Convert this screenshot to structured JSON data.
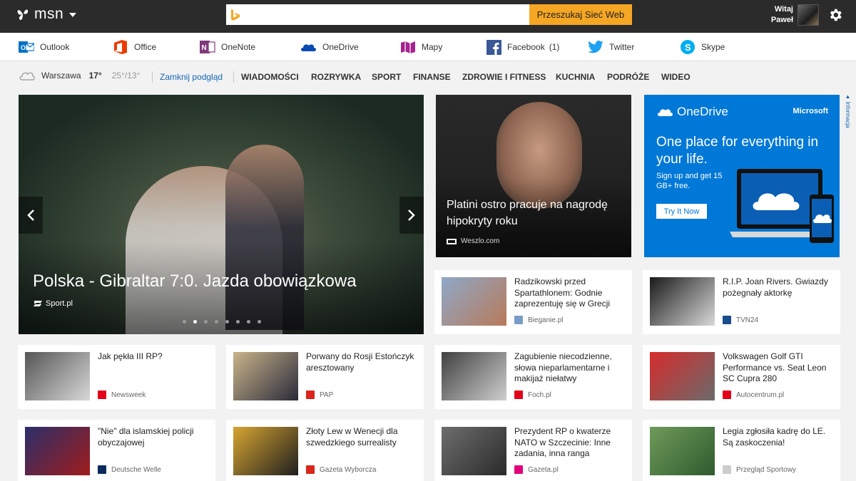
{
  "header": {
    "logo_text": "msn",
    "search_placeholder": "",
    "search_button": "Przeszukaj Sieć Web",
    "user_greeting": "Witaj",
    "user_name": "Paweł"
  },
  "apps": [
    {
      "label": "Outlook",
      "icon": "outlook-icon",
      "color": "#0072c6"
    },
    {
      "label": "Office",
      "icon": "office-icon",
      "color": "#eb3c00"
    },
    {
      "label": "OneNote",
      "icon": "onenote-icon",
      "color": "#80397b"
    },
    {
      "label": "OneDrive",
      "icon": "onedrive-icon",
      "color": "#094ab2"
    },
    {
      "label": "Mapy",
      "icon": "maps-icon",
      "color": "#a4238e"
    },
    {
      "label": "Facebook",
      "icon": "facebook-icon",
      "color": "#3b5998",
      "count": "(1)"
    },
    {
      "label": "Twitter",
      "icon": "twitter-icon",
      "color": "#1da1f2"
    },
    {
      "label": "Skype",
      "icon": "skype-icon",
      "color": "#00aff0"
    }
  ],
  "weather": {
    "city": "Warszawa",
    "temp": "17°",
    "range": "25°/13°",
    "icon": "cloud-icon"
  },
  "nav": {
    "close_preview": "Zamknij podgląd",
    "categories": [
      "WIADOMOŚCI",
      "ROZRYWKA",
      "SPORT",
      "FINANSE",
      "ZDROWIE I FITNESS",
      "KUCHNIA",
      "PODRÓŻE",
      "WIDEO"
    ]
  },
  "hero": {
    "title": "Polska - Gibraltar 7:0. Jazda obowiązkowa",
    "source": "Sport.pl",
    "slide_count": 8,
    "active_slide": 2
  },
  "feature": {
    "title": "Platini ostro pracuje na nagrodę hipokryty roku",
    "source": "Weszlo.com"
  },
  "ad": {
    "brand": "OneDrive",
    "company": "Microsoft",
    "headline": "One place for everything in your life.",
    "sub": "Sign up and get 15 GB+ free.",
    "button": "Try It Now",
    "info_label": "Informacja"
  },
  "cards": [
    {
      "title": "Radzikowski przed Spartathlonem: Godnie zaprezentuję się w Grecji",
      "source": "Bieganie.pl",
      "logo_color": "#7a9cc6",
      "thumb_from": "#8fa8c8",
      "thumb_to": "#b87a5a"
    },
    {
      "title": "R.I.P. Joan Rivers. Gwiazdy pożegnały aktorkę",
      "source": "TVN24",
      "logo_color": "#1a4d8c",
      "thumb_from": "#1a1a1a",
      "thumb_to": "#d9d9d9"
    },
    {
      "title": "Jak pękła III RP?",
      "source": "Newsweek",
      "logo_color": "#e2001a",
      "thumb_from": "#555555",
      "thumb_to": "#d8d8d8"
    },
    {
      "title": "Porwany do Rosji Estończyk aresztowany",
      "source": "PAP",
      "logo_color": "#d9261c",
      "thumb_from": "#c9b48a",
      "thumb_to": "#2a2a3a"
    },
    {
      "title": "Zagubienie niecodzienne, słowa nieparlamentarne i makijaż niełatwy",
      "source": "Foch.pl",
      "logo_color": "#e2001a",
      "thumb_from": "#404040",
      "thumb_to": "#cfcfcf"
    },
    {
      "title": "Volkswagen Golf GTI Performance vs. Seat Leon SC Cupra 280",
      "source": "Autocentrum.pl",
      "logo_color": "#e2001a",
      "thumb_from": "#d62b2b",
      "thumb_to": "#6b6b6b"
    },
    {
      "title": "\"Nie\" dla islamskiej policji obyczajowej",
      "source": "Deutsche Welle",
      "logo_color": "#0a2b5c",
      "thumb_from": "#2a2f6a",
      "thumb_to": "#a01c1c"
    },
    {
      "title": "Złoty Lew w Wenecji dla szwedzkiego surrealisty",
      "source": "Gazeta Wyborcza",
      "logo_color": "#d9261c",
      "thumb_from": "#d7a531",
      "thumb_to": "#1f1f1f"
    },
    {
      "title": "Prezydent RP o kwaterze NATO w Szczecinie: Inne zadania, inna ranga",
      "source": "Gazeta.pl",
      "logo_color": "#e2007a",
      "thumb_from": "#6d6d6d",
      "thumb_to": "#2b2b2b"
    },
    {
      "title": "Legia zgłosiła kadrę do LE. Są zaskoczenia!",
      "source": "Przegląd Sportowy",
      "logo_color": "#cccccc",
      "thumb_from": "#6e9a5a",
      "thumb_to": "#2f5b2f"
    }
  ]
}
